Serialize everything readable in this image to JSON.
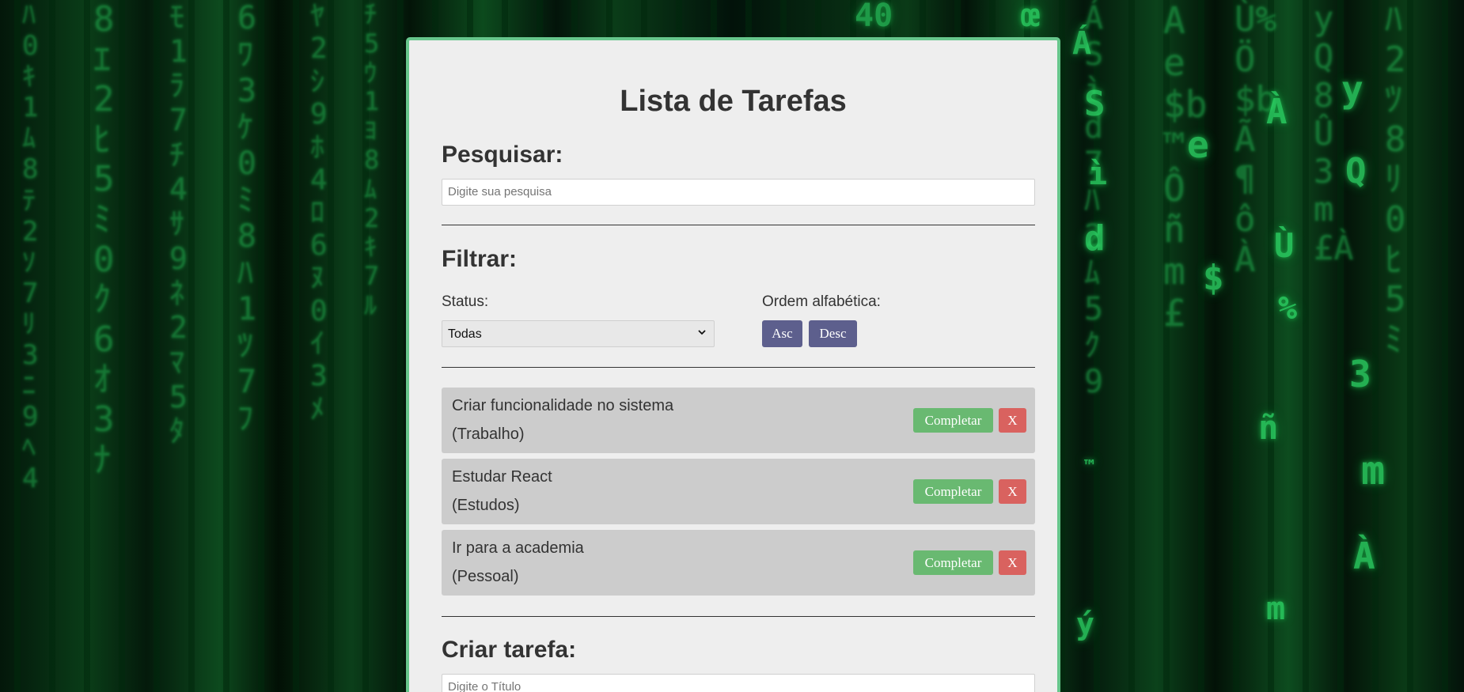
{
  "page": {
    "title": "Lista de Tarefas"
  },
  "search": {
    "heading": "Pesquisar:",
    "placeholder": "Digite sua pesquisa",
    "icon": "search-input"
  },
  "filter": {
    "heading": "Filtrar:",
    "status_label": "Status:",
    "status_selected": "Todas",
    "order_label": "Ordem alfabética:",
    "asc_label": "Asc",
    "desc_label": "Desc"
  },
  "tasks": [
    {
      "title": "Criar funcionalidade no sistema",
      "category": "(Trabalho)",
      "complete_label": "Completar",
      "delete_label": "X"
    },
    {
      "title": "Estudar React",
      "category": "(Estudos)",
      "complete_label": "Completar",
      "delete_label": "X"
    },
    {
      "title": "Ir para a academia",
      "category": "(Pessoal)",
      "complete_label": "Completar",
      "delete_label": "X"
    }
  ],
  "create": {
    "heading": "Criar tarefa:",
    "title_placeholder": "Digite o Título"
  },
  "colors": {
    "card_border": "#67c68c",
    "card_background": "#eeeeee",
    "task_background": "#cccccc",
    "sort_button": "#5d5f8d",
    "complete_button": "#69b971",
    "delete_button": "#d9625f",
    "background_glow": "#2ee06a"
  }
}
